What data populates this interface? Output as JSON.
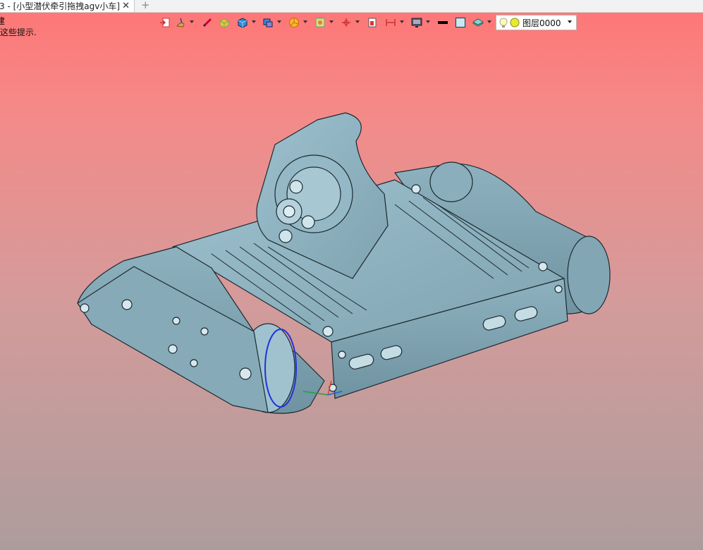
{
  "document_tab": {
    "title": "3 - [小型潜伏牵引拖拽agv小车]",
    "close_glyph": "✕",
    "add_glyph": "+"
  },
  "prompt": {
    "line1": "建",
    "line2": "消这些提示."
  },
  "toolbar": {
    "icons": [
      "exit-sketch-icon",
      "paint-brush-icon",
      "measure-pencil-icon",
      "box-highlight-icon",
      "solid-cube-icon",
      "shade-mode-icon",
      "pie-color-icon",
      "render-view-icon",
      "axis-origin-icon",
      "section-plane-icon",
      "dimension-icon",
      "monitor-display-icon",
      "line-weight-icon",
      "fill-color-swatch-icon",
      "layer-stack-icon"
    ],
    "layer": {
      "value": "图层0000",
      "visible_icon": "bulb-icon",
      "color_icon": "yellow-dot-icon"
    }
  },
  "colors": {
    "background_top": "#ff7575",
    "background_bottom": "#ad9c9c",
    "model_fill": "#8fb3c1",
    "model_edge": "#1c2a30",
    "highlight_blue": "#2233dd"
  }
}
